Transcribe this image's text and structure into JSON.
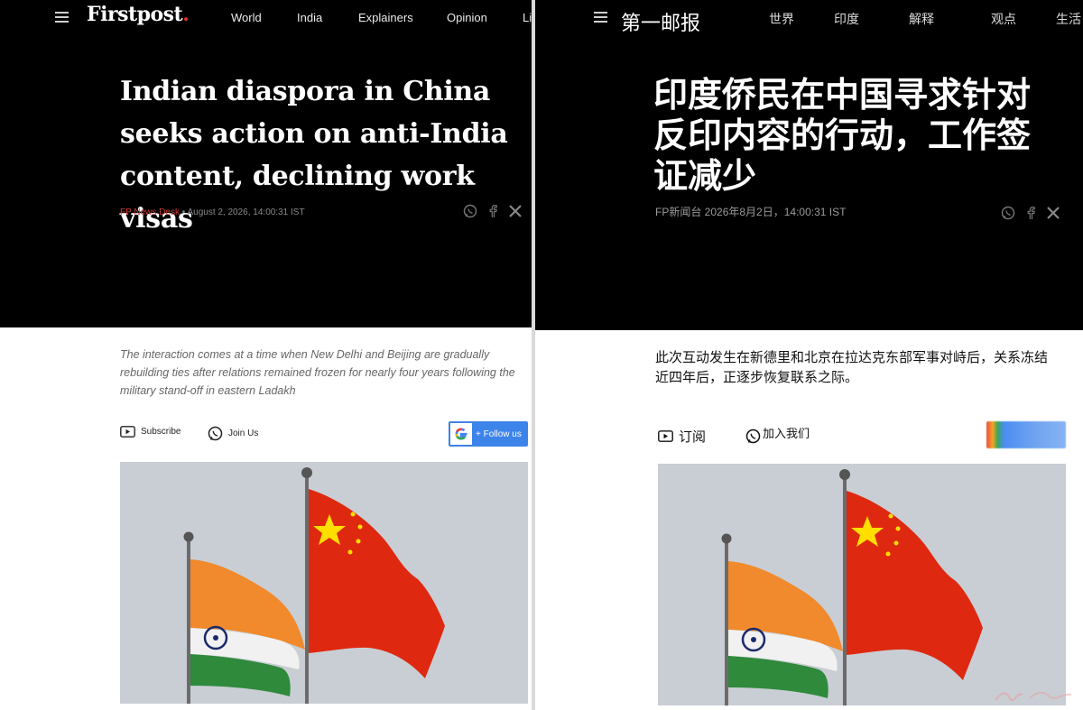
{
  "left": {
    "logo": "Firstpost",
    "logo_dot": ".",
    "nav": [
      "World",
      "India",
      "Explainers",
      "Opinion",
      "Li"
    ],
    "headline": "Indian diaspora in China seeks action on anti-India content, declining work visas",
    "author": "FP News Desk",
    "date": " • August 2, 2026, 14:00:31 IST",
    "summary": "The interaction comes at a time when New Delhi and Beijing are gradually rebuilding ties after relations remained frozen for nearly four years following the military stand-off in eastern Ladakh",
    "subscribe": "Subscribe",
    "join": "Join Us",
    "follow": "+ Follow us"
  },
  "right": {
    "logo": "第一邮报",
    "nav": [
      "世界",
      "印度",
      "解释",
      "观点",
      "生活"
    ],
    "headline": "印度侨民在中国寻求针对反印内容的行动，工作签证减少",
    "author": "FP新闻台",
    "date": " 2026年8月2日，14:00:31 IST",
    "summary": "此次互动发生在新德里和北京在拉达克东部军事对峙后，关系冻结近四年后，正逐步恢复联系之际。",
    "subscribe": "订阅",
    "join": "加入我们"
  },
  "icons": {
    "menu": "hamburger-menu-icon",
    "whatsapp": "whatsapp-icon",
    "facebook": "facebook-icon",
    "x": "x-icon",
    "youtube": "youtube-play-icon",
    "google": "google-g-icon"
  },
  "colors": {
    "hero_bg": "#000000",
    "brand_red": "#e0312b",
    "follow_blue": "#3c83ea",
    "china_red": "#de2910",
    "india_saffron": "#f08a2c",
    "india_green": "#2f8a3c"
  }
}
